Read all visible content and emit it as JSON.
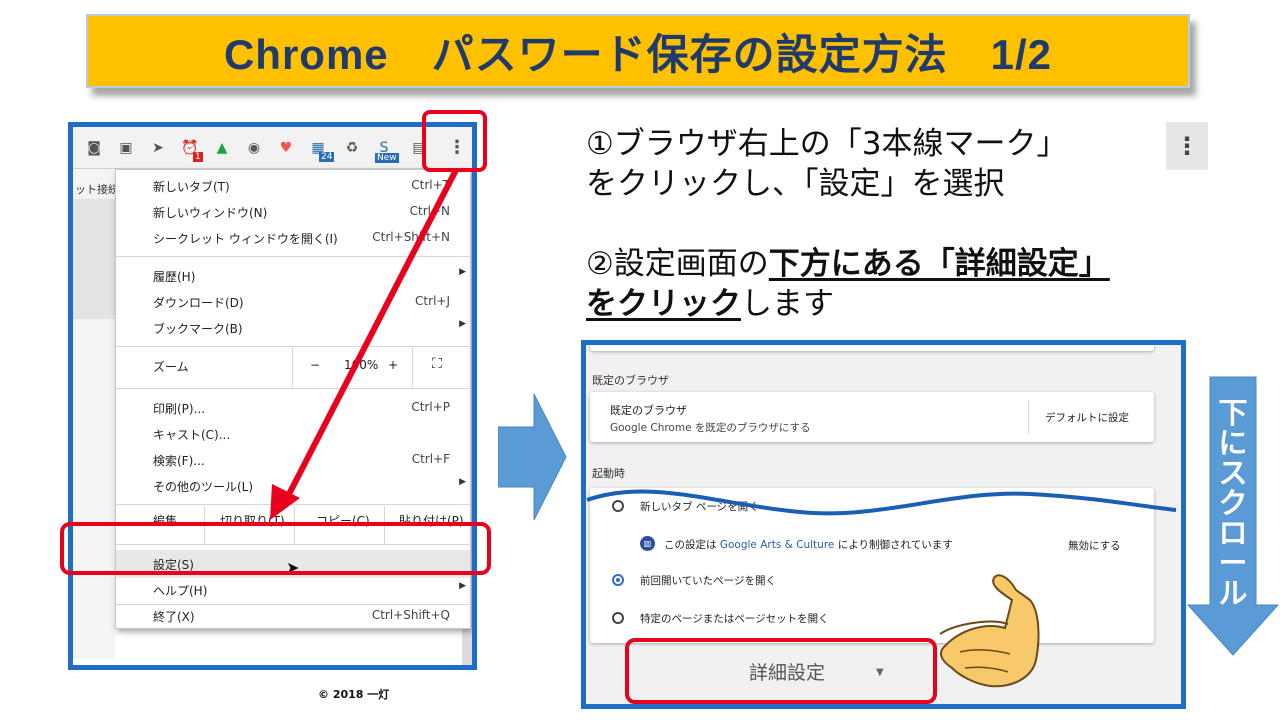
{
  "title": "Chrome　パスワード保存の設定方法　1/2",
  "instructions": {
    "step1_line1": "①ブラウザ右上の「3本線マーク」",
    "step1_line2": "をクリックし、「設定」を選択",
    "step2_line1_prefix": "②設定画面の",
    "step2_line1_emphasis": "下方にある「詳細設定」",
    "step2_line2_emphasis": "をクリック",
    "step2_line2_suffix": "します",
    "kebab_symbol": "⋮"
  },
  "chrome_menu": {
    "sidebar_cut_text": "ット接続",
    "toolbar_badges": {
      "count_a": "1",
      "count_b": "24",
      "new_label": "New"
    },
    "items": [
      {
        "label": "新しいタブ(T)",
        "shortcut": "Ctrl+T"
      },
      {
        "label": "新しいウィンドウ(N)",
        "shortcut": "Ctrl+N"
      },
      {
        "label": "シークレット ウィンドウを開く(I)",
        "shortcut": "Ctrl+Shift+N"
      },
      {
        "label": "履歴(H)",
        "shortcut": ""
      },
      {
        "label": "ダウンロード(D)",
        "shortcut": "Ctrl+J"
      },
      {
        "label": "ブックマーク(B)",
        "shortcut": ""
      },
      {
        "label": "印刷(P)...",
        "shortcut": "Ctrl+P"
      },
      {
        "label": "キャスト(C)...",
        "shortcut": ""
      },
      {
        "label": "検索(F)...",
        "shortcut": "Ctrl+F"
      },
      {
        "label": "その他のツール(L)",
        "shortcut": ""
      },
      {
        "label": "設定(S)",
        "shortcut": ""
      },
      {
        "label": "ヘルプ(H)",
        "shortcut": ""
      },
      {
        "label": "終了(X)",
        "shortcut": "Ctrl+Shift+Q"
      }
    ],
    "zoom": {
      "label": "ズーム",
      "minus": "−",
      "value": "100%",
      "plus": "+",
      "fullscreen": "⛶"
    },
    "edit": {
      "label": "編集",
      "cut": "切り取り(T)",
      "copy": "コピー(C)",
      "paste": "貼り付け(P)"
    }
  },
  "settings": {
    "default_browser_heading": "既定のブラウザ",
    "default_browser_title": "既定のブラウザ",
    "default_browser_sub": "Google Chrome を既定のブラウザにする",
    "default_browser_button": "デフォルトに設定",
    "startup_heading": "起動時",
    "startup_options": [
      "新しいタブ ページを開く",
      "前回開いていたページを開く",
      "特定のページまたはページセットを開く"
    ],
    "managed_prefix": "この設定は",
    "managed_brand": "Google Arts & Culture",
    "managed_suffix": "により制御されています",
    "disable_button": "無効にする",
    "advanced_button": "詳細設定",
    "advanced_caret": "▼"
  },
  "scroll_label": "下にスクロール",
  "copyright": "© 2018 一灯",
  "colors": {
    "banner": "#ffc000",
    "banner_text": "#1f3b6e",
    "frame_blue": "#1e6ec8",
    "highlight_red": "#e8001c",
    "arrow_blue": "#5b9bd5"
  }
}
